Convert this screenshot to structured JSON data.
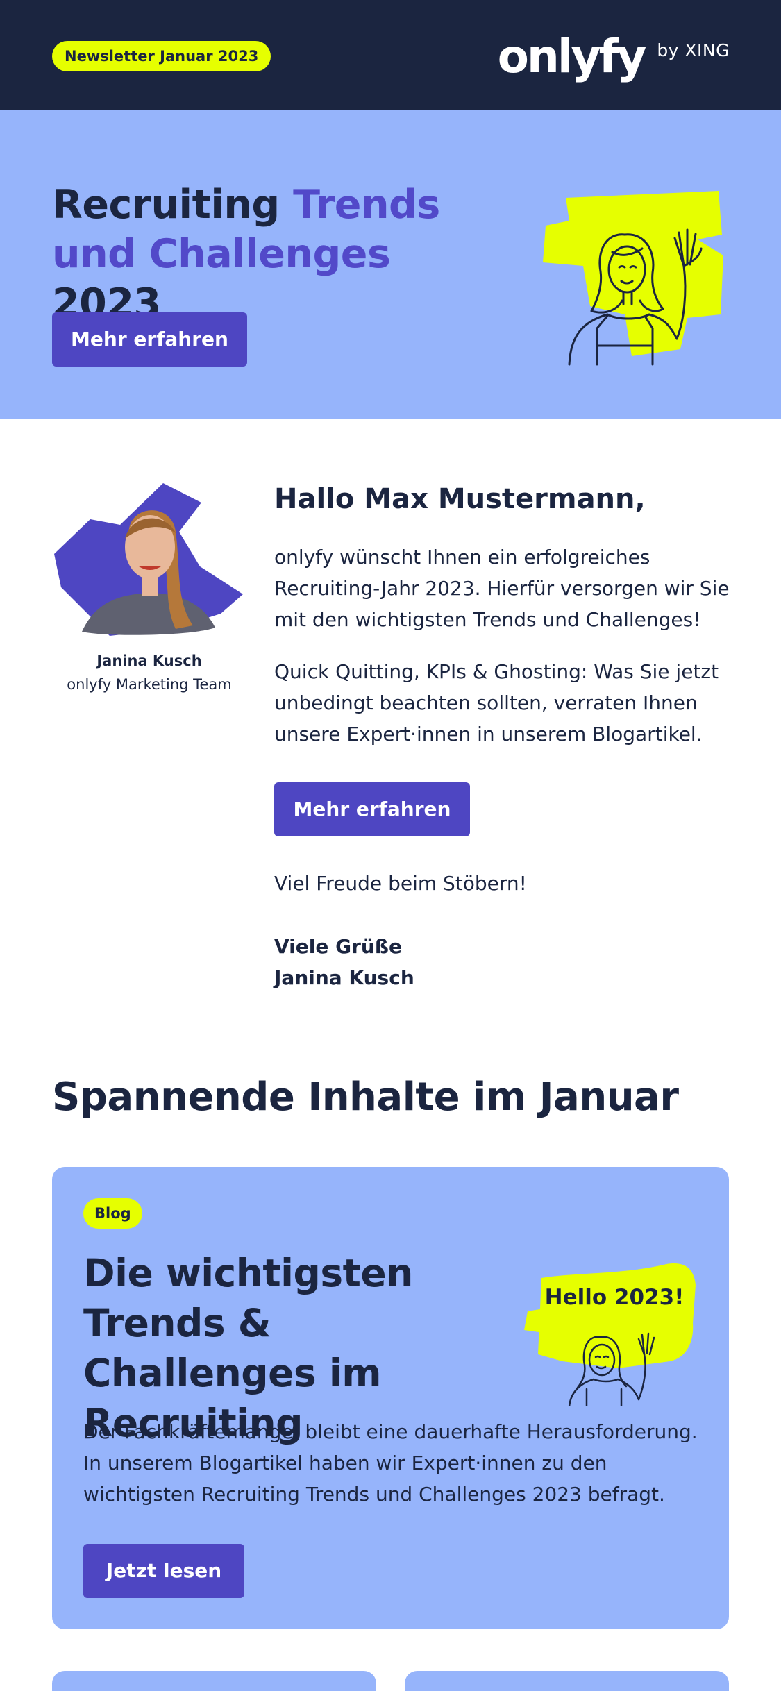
{
  "header": {
    "badge": "Newsletter Januar 2023",
    "logo_word": "onlyfy",
    "logo_by": "by XING",
    "background_color": "#1b2540"
  },
  "hero": {
    "title_part1": "Recruiting ",
    "title_accent": "Trends und Challenges",
    "title_part2": " 2023",
    "button_label": "Mehr erfahren",
    "background_color": "#96b4fb",
    "accent_color": "#5249c9",
    "illustration": "waving-woman-illustration"
  },
  "intro": {
    "author_name": "Janina Kusch",
    "author_team": "onlyfy Marketing Team",
    "greeting": "Hallo Max Mustermann,",
    "paragraph1": "onlyfy wünscht Ihnen ein erfolgreiches Recruiting-Jahr 2023. Hierfür versorgen wir Sie mit den wichtigsten Trends und Challenges!",
    "paragraph2": "Quick Quitting, KPIs & Ghosting: Was Sie jetzt unbedingt beachten sollten, verraten Ihnen unsere Expert·innen in unserem Blogartikel.",
    "button_label": "Mehr erfahren",
    "closing": "Viel Freude beim Stöbern!",
    "sign_line1": "Viele Grüße",
    "sign_line2": "Janina Kusch"
  },
  "section": {
    "title": "Spannende Inhalte im Januar"
  },
  "blog_card": {
    "tag": "Blog",
    "title": "Die wichtigsten Trends & Challenges im Recruiting",
    "illustration_text": "Hello 2023!",
    "text": "Der Fachkräftemangel bleibt eine dauerhafte Herausforderung. In unserem Blogartikel haben wir Expert·innen zu den wichtigsten Recruiting Trends und Challenges 2023 befragt.",
    "button_label": "Jetzt lesen"
  },
  "colors": {
    "primary_button": "#4e46c2",
    "highlight_yellow": "#e6ff00",
    "dark_navy": "#1b2540",
    "light_blue": "#96b4fb"
  }
}
